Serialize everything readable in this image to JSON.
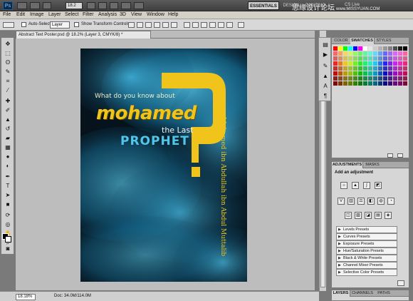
{
  "app": {
    "logo": "Ps",
    "zoom_level": "18.2",
    "workspaces": [
      "ESSENTIALS",
      "DESIGN",
      "PAINTING"
    ],
    "cs_live": "CS Live",
    "watermark": "思缘设计论坛",
    "watermark_url": "www.MISSYUAN.COM"
  },
  "menu": [
    "File",
    "Edit",
    "Image",
    "Layer",
    "Select",
    "Filter",
    "Analysis",
    "3D",
    "View",
    "Window",
    "Help"
  ],
  "options": {
    "auto_select_label": "Auto-Select:",
    "auto_select_value": "Layer",
    "transform_label": "Show Transform Controls"
  },
  "document": {
    "tab_title": "Abstract Text Poster.psd @ 18.2% (Layer 3, CMYK/8) *",
    "zoom_field": "18.18%",
    "doc_info": "Doc: 34.0M/114.0M"
  },
  "poster": {
    "line1": "What do you know about",
    "line2": "mohamed",
    "line3": "the Last",
    "line4": "PROPHET",
    "vertical": "Mohamed ibn Abdullah ibn Abdul Muttalib",
    "colors": {
      "yellow": "#f0c41a",
      "cyan": "#4fc6ea",
      "dark": "#07131c"
    }
  },
  "panels": {
    "color_tabs": [
      "COLOR",
      "SWATCHES",
      "STYLES"
    ],
    "adjust_tabs": [
      "ADJUSTMENTS",
      "MASKS"
    ],
    "adjust_title": "Add an adjustment",
    "presets": [
      "Levels Presets",
      "Curves Presets",
      "Exposure Presets",
      "Hue/Saturation Presets",
      "Black & White Presets",
      "Channel Mixer Presets",
      "Selective Color Presets"
    ],
    "layers_tabs": [
      "LAYERS",
      "CHANNELS",
      "PATHS"
    ]
  },
  "tool_icons": [
    "move-tool-icon",
    "marquee-tool-icon",
    "lasso-tool-icon",
    "quick-select-tool-icon",
    "crop-tool-icon",
    "eyedropper-tool-icon",
    "spot-heal-tool-icon",
    "brush-tool-icon",
    "stamp-tool-icon",
    "history-brush-tool-icon",
    "eraser-tool-icon",
    "gradient-tool-icon",
    "blur-tool-icon",
    "dodge-tool-icon",
    "pen-tool-icon",
    "type-tool-icon",
    "path-select-tool-icon",
    "shape-tool-icon",
    "3d-rotate-tool-icon",
    "3d-camera-tool-icon",
    "hand-tool-icon",
    "zoom-tool-icon"
  ]
}
